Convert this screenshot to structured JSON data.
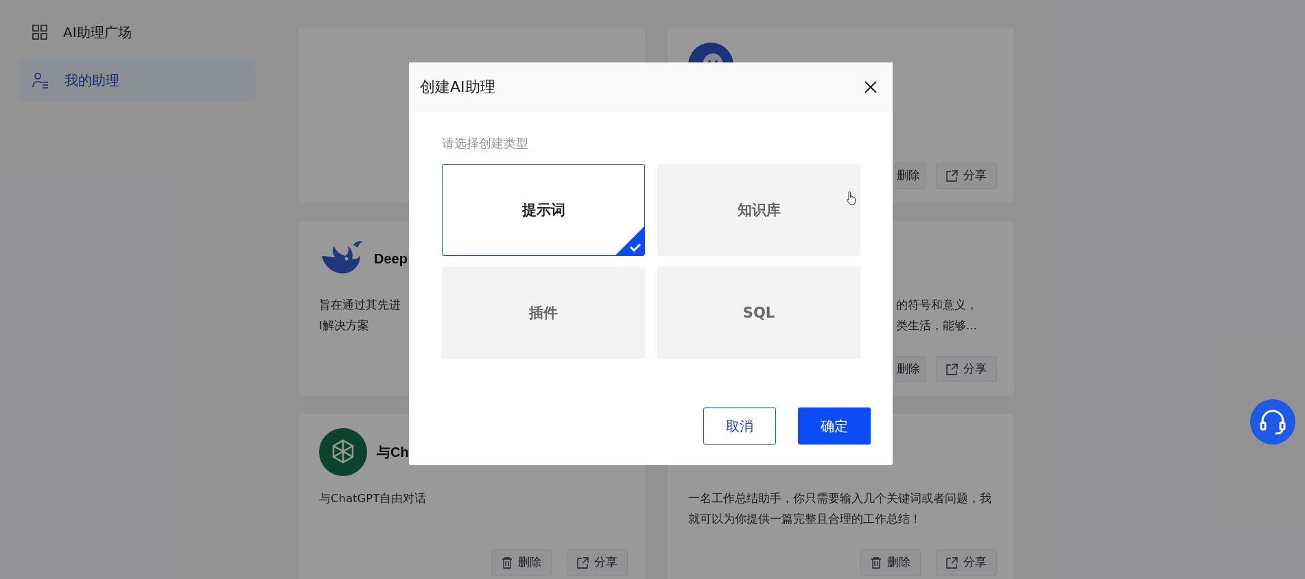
{
  "sidebar": {
    "items": [
      {
        "label": "AI助理广场",
        "selected": false
      },
      {
        "label": "我的助理",
        "selected": true
      }
    ]
  },
  "cards": [
    {
      "kind": "plain"
    },
    {
      "kind": "robot",
      "actions": [
        {
          "label": "删除",
          "kind": "delete",
          "icon": false
        },
        {
          "label": "分享",
          "kind": "share",
          "icon": true
        }
      ]
    },
    {
      "kind": "whale",
      "title": "Deep",
      "description": [
        "旨在通过其先进",
        "I解决方案"
      ]
    },
    {
      "kind": "plain",
      "description": [
        "的符号和意义，",
        "类生活，能够..."
      ],
      "actions": [
        {
          "label": "删除",
          "kind": "delete",
          "icon": false
        },
        {
          "label": "分享",
          "kind": "share",
          "icon": true
        }
      ]
    },
    {
      "kind": "chatgpt",
      "title": "与Ch",
      "description": [
        "与ChatGPT自由对话"
      ],
      "actions": [
        {
          "label": "删除",
          "kind": "delete",
          "icon": true
        },
        {
          "label": "分享",
          "kind": "share",
          "icon": true
        }
      ]
    },
    {
      "kind": "plain",
      "description": [
        "一名工作总结助手，你只需要输入几个关键词或者问题，我就可以为你提供一篇完整且合理的工作总结！"
      ],
      "actions": [
        {
          "label": "删除",
          "kind": "delete",
          "icon": true
        },
        {
          "label": "分享",
          "kind": "share",
          "icon": true
        }
      ]
    }
  ],
  "dialog": {
    "title": "创建AI助理",
    "close": true,
    "prompt": "请选择创建类型",
    "options": [
      {
        "label": "提示词",
        "selected": true
      },
      {
        "label": "知识库",
        "selected": false
      },
      {
        "label": "插件",
        "selected": false
      },
      {
        "label": "SQL",
        "selected": false
      }
    ],
    "buttons": [
      {
        "label": "取消",
        "kind": "secondary"
      },
      {
        "label": "确定",
        "kind": "primary"
      }
    ]
  },
  "help_button": true
}
